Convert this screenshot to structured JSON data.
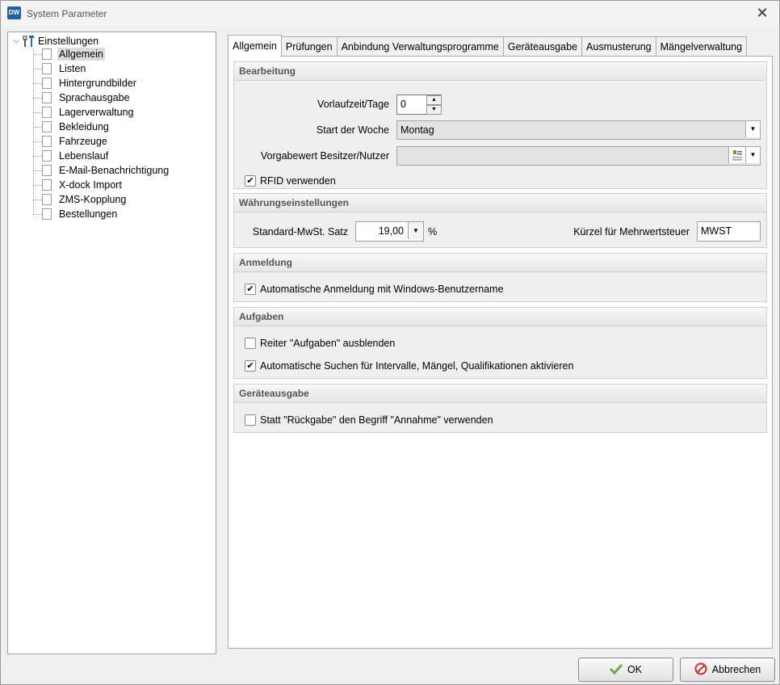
{
  "window": {
    "title": "System Parameter",
    "app_icon_text": "DW"
  },
  "tree": {
    "root_label": "Einstellungen",
    "items": [
      {
        "label": "Allgemein",
        "selected": true
      },
      {
        "label": "Listen"
      },
      {
        "label": "Hintergrundbilder"
      },
      {
        "label": "Sprachausgabe"
      },
      {
        "label": "Lagerverwaltung"
      },
      {
        "label": "Bekleidung"
      },
      {
        "label": "Fahrzeuge"
      },
      {
        "label": "Lebenslauf"
      },
      {
        "label": "E-Mail-Benachrichtigung"
      },
      {
        "label": "X-dock Import"
      },
      {
        "label": "ZMS-Kopplung"
      },
      {
        "label": "Bestellungen"
      }
    ]
  },
  "tabs": [
    {
      "label": "Allgemein",
      "active": true
    },
    {
      "label": "Prüfungen"
    },
    {
      "label": "Anbindung Verwaltungsprogramme"
    },
    {
      "label": "Geräteausgabe"
    },
    {
      "label": "Ausmusterung"
    },
    {
      "label": "Mängelverwaltung"
    }
  ],
  "bearbeitung": {
    "header": "Bearbeitung",
    "vorlaufzeit_label": "Vorlaufzeit/Tage",
    "vorlaufzeit_value": "0",
    "start_woche_label": "Start der Woche",
    "start_woche_value": "Montag",
    "vorgabewert_label": "Vorgabewert Besitzer/Nutzer",
    "vorgabewert_value": "",
    "rfid_label": "RFID verwenden",
    "rfid_checked": true
  },
  "waehrung": {
    "header": "Währungseinstellungen",
    "mwst_label": "Standard-MwSt. Satz",
    "mwst_value": "19,00",
    "mwst_unit": "%",
    "kuerzel_label": "Kürzel für Mehrwertsteuer",
    "kuerzel_value": "MWST"
  },
  "anmeldung": {
    "header": "Anmeldung",
    "auto_label": "Automatische Anmeldung mit Windows-Benutzername",
    "auto_checked": true
  },
  "aufgaben": {
    "header": "Aufgaben",
    "reiter_label": "Reiter \"Aufgaben\" ausblenden",
    "reiter_checked": false,
    "suche_label": "Automatische Suchen für Intervalle, Mängel, Qualifikationen aktivieren",
    "suche_checked": true
  },
  "geraeteausgabe": {
    "header": "Geräteausgabe",
    "rueckgabe_label": "Statt \"Rückgabe\" den Begriff \"Annahme\" verwenden",
    "rueckgabe_checked": false
  },
  "footer": {
    "ok_label": "OK",
    "cancel_label": "Abbrechen"
  }
}
